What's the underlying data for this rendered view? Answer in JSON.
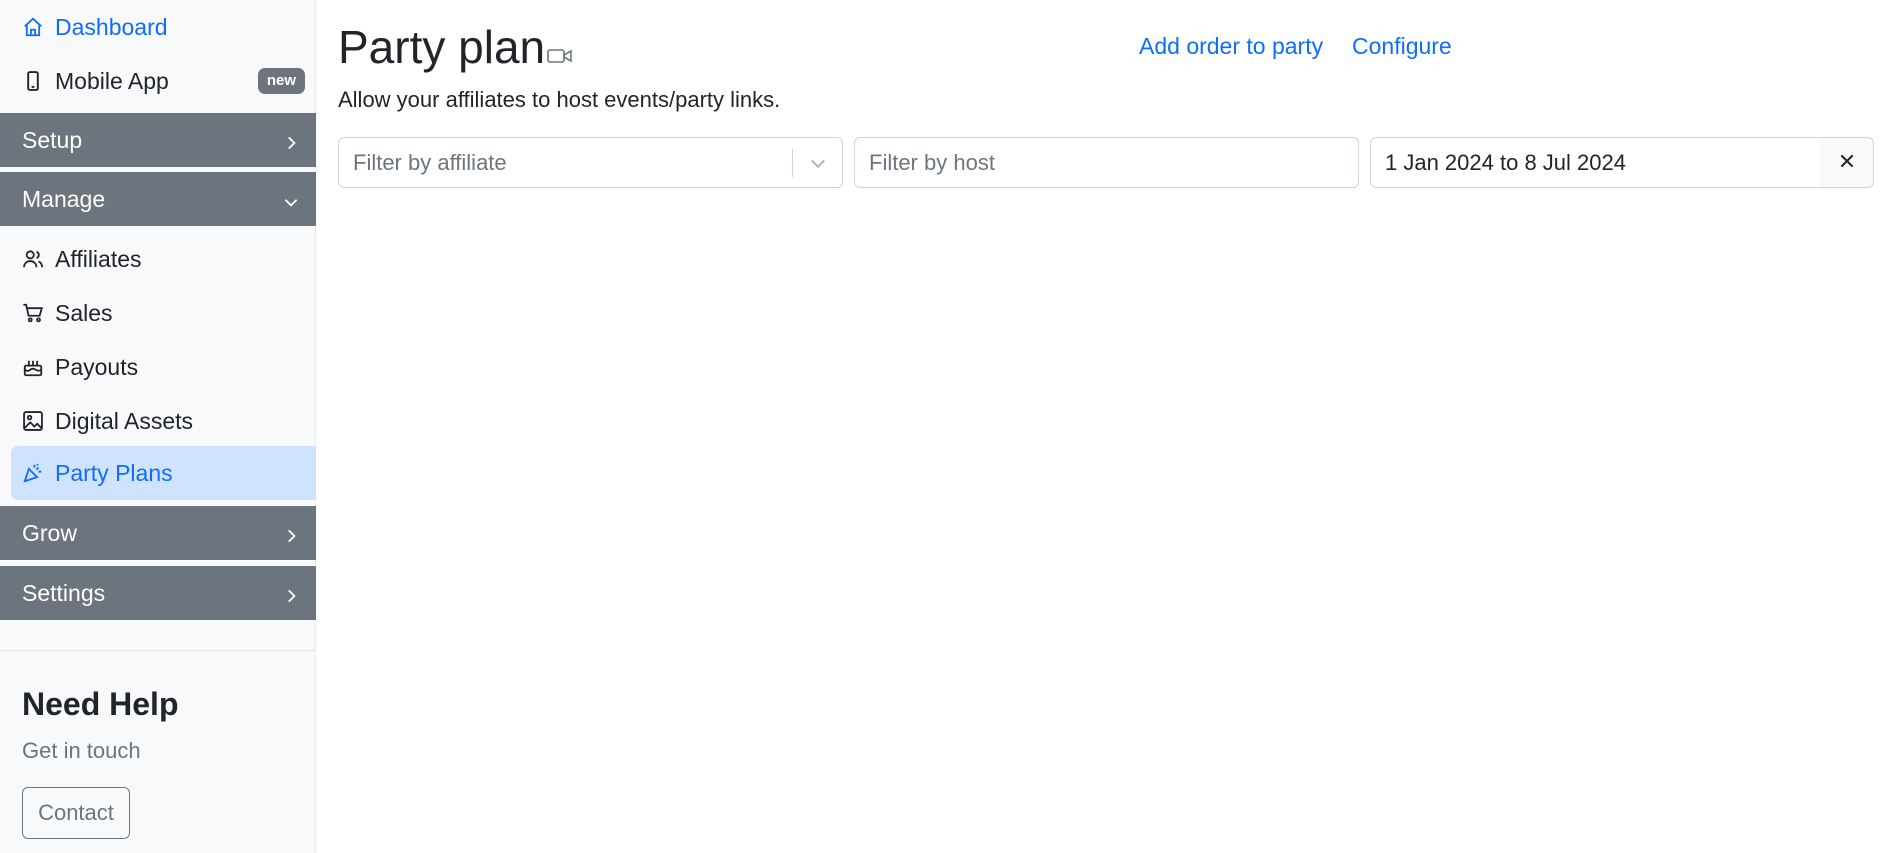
{
  "sidebar": {
    "dashboard": {
      "label": "Dashboard",
      "icon": "house-icon"
    },
    "mobile_app": {
      "label": "Mobile App",
      "icon": "phone-icon",
      "badge": "new"
    },
    "sections": {
      "setup": "Setup",
      "manage": "Manage",
      "grow": "Grow",
      "settings": "Settings"
    },
    "manage_items": [
      {
        "label": "Affiliates",
        "icon": "people-icon"
      },
      {
        "label": "Sales",
        "icon": "cart-icon"
      },
      {
        "label": "Payouts",
        "icon": "cake-icon"
      },
      {
        "label": "Digital Assets",
        "icon": "image-icon"
      },
      {
        "label": "Party Plans",
        "icon": "party-popper-icon",
        "active": true
      }
    ],
    "help": {
      "title": "Need Help",
      "subtitle": "Get in touch",
      "contact_label": "Contact"
    }
  },
  "main": {
    "title": "Party plan",
    "subtitle": "Allow your affiliates to host events/party links.",
    "links": {
      "add_order": "Add order to party",
      "configure": "Configure"
    },
    "filters": {
      "affiliate_placeholder": "Filter by affiliate",
      "host_placeholder": "Filter by host",
      "date_range": "1 Jan 2024 to 8 Jul 2024"
    }
  },
  "colors": {
    "accent": "#0d6efd",
    "active_bg": "#cfe2ff",
    "section_bg": "#6c757d",
    "sidebar_bg": "#f8f9fa"
  }
}
